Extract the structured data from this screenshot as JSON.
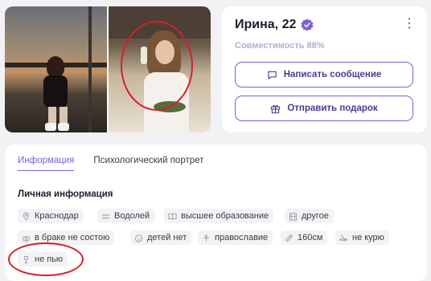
{
  "profile": {
    "name": "Ирина, 22",
    "compatibility": "Совместимость 88%",
    "more_icon": "more-vertical-icon",
    "verified_icon": "verified-badge-icon",
    "accent_color": "#7b5ed6"
  },
  "actions": {
    "message_label": "Написать сообщение",
    "gift_label": "Отправить подарок"
  },
  "tabs": [
    {
      "label": "Информация",
      "active": true
    },
    {
      "label": "Психологический портрет",
      "active": false
    }
  ],
  "personal": {
    "title": "Личная информация",
    "chips": [
      {
        "label": "Краснодар",
        "icon": "location-icon"
      },
      {
        "label": "Водолей",
        "icon": "aquarius-icon"
      },
      {
        "label": "высшее образование",
        "icon": "book-icon"
      },
      {
        "label": "другое",
        "icon": "building-icon"
      },
      {
        "label": "в браке не состою",
        "icon": "rings-icon"
      },
      {
        "label": "детей нет",
        "icon": "child-icon"
      },
      {
        "label": "православие",
        "icon": "religion-icon"
      },
      {
        "label": "160см",
        "icon": "ruler-icon"
      },
      {
        "label": "не курю",
        "icon": "no-smoking-icon"
      },
      {
        "label": "не пью",
        "icon": "no-drinking-icon"
      }
    ]
  }
}
